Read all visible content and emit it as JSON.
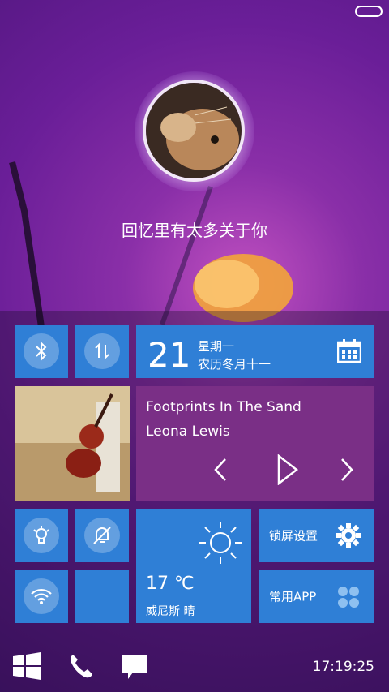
{
  "lockscreen": {
    "tagline": "回忆里有太多关于你"
  },
  "tiles": {
    "bluetooth_icon": "bluetooth-icon",
    "data_icon": "data-transfer-icon",
    "date": {
      "day": "21",
      "weekday": "星期一",
      "lunar": "农历冬月十一",
      "icon": "calendar-icon"
    },
    "music": {
      "title": "Footprints In The Sand",
      "artist": "Leona Lewis"
    },
    "flashlight_icon": "flashlight-icon",
    "mute_icon": "bell-mute-icon",
    "wifi_icon": "wifi-icon",
    "weather": {
      "temperature": "17 ℃",
      "city_condition": "威尼斯 晴",
      "icon": "sun-icon"
    },
    "settings": {
      "label": "锁屏设置",
      "icon": "gear-icon"
    },
    "apps": {
      "label": "常用APP",
      "icon": "apps-icon"
    }
  },
  "dock": {
    "time": "17:19:25"
  },
  "colors": {
    "tile_blue": "#2f7fd6",
    "tile_purple": "#7a2f86"
  }
}
